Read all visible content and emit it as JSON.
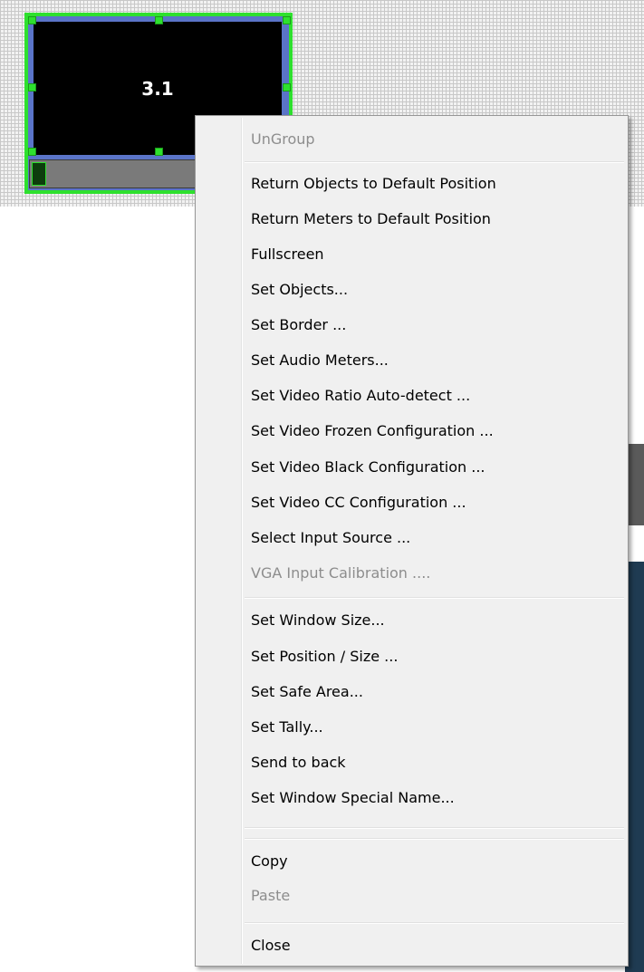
{
  "window": {
    "label": "3.1"
  },
  "context_menu": {
    "items": [
      {
        "label": "UnGroup",
        "enabled": false
      },
      {
        "label": "Return Objects to Default Position",
        "enabled": true
      },
      {
        "label": "Return Meters to Default Position",
        "enabled": true
      },
      {
        "label": "Fullscreen",
        "enabled": true
      },
      {
        "label": "Set Objects...",
        "enabled": true
      },
      {
        "label": "Set Border ...",
        "enabled": true
      },
      {
        "label": "Set Audio Meters...",
        "enabled": true
      },
      {
        "label": "Set Video Ratio Auto-detect ...",
        "enabled": true
      },
      {
        "label": "Set Video Frozen Configuration ...",
        "enabled": true
      },
      {
        "label": "Set Video Black Configuration ...",
        "enabled": true
      },
      {
        "label": "Set Video CC Configuration ...",
        "enabled": true
      },
      {
        "label": "Select Input Source ...",
        "enabled": true
      },
      {
        "label": "VGA Input Calibration ....",
        "enabled": false
      },
      {
        "label": "Set Window Size...",
        "enabled": true
      },
      {
        "label": "Set Position / Size ...",
        "enabled": true
      },
      {
        "label": "Set Safe Area...",
        "enabled": true
      },
      {
        "label": "Set Tally...",
        "enabled": true
      },
      {
        "label": "Send to back",
        "enabled": true
      },
      {
        "label": "Set Window Special Name...",
        "enabled": true
      },
      {
        "label": "Copy",
        "enabled": true
      },
      {
        "label": "Paste",
        "enabled": false
      },
      {
        "label": "Close",
        "enabled": true
      }
    ]
  },
  "colors": {
    "selection_green": "#2ee02e",
    "frame_blue": "#5a74c8",
    "menu_background": "#f0f0f0",
    "disabled_text": "#8d8d8d"
  }
}
